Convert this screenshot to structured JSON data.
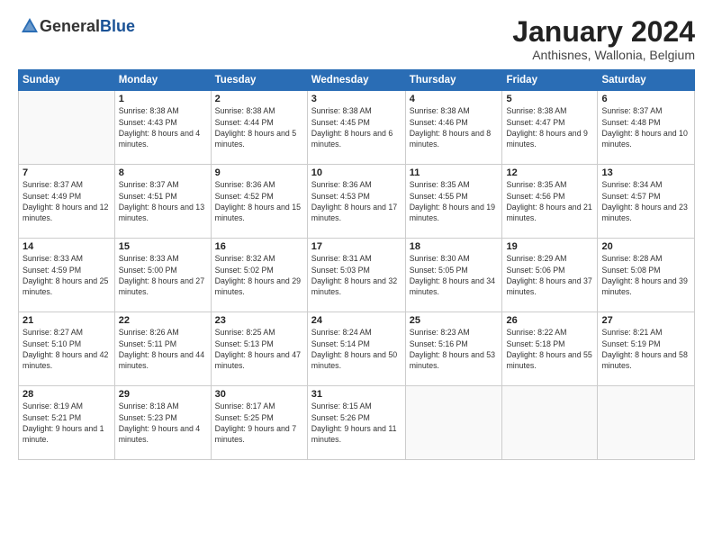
{
  "logo": {
    "general": "General",
    "blue": "Blue"
  },
  "title": "January 2024",
  "location": "Anthisnes, Wallonia, Belgium",
  "weekdays": [
    "Sunday",
    "Monday",
    "Tuesday",
    "Wednesday",
    "Thursday",
    "Friday",
    "Saturday"
  ],
  "weeks": [
    [
      {
        "day": "",
        "sunrise": "",
        "sunset": "",
        "daylight": ""
      },
      {
        "day": "1",
        "sunrise": "Sunrise: 8:38 AM",
        "sunset": "Sunset: 4:43 PM",
        "daylight": "Daylight: 8 hours and 4 minutes."
      },
      {
        "day": "2",
        "sunrise": "Sunrise: 8:38 AM",
        "sunset": "Sunset: 4:44 PM",
        "daylight": "Daylight: 8 hours and 5 minutes."
      },
      {
        "day": "3",
        "sunrise": "Sunrise: 8:38 AM",
        "sunset": "Sunset: 4:45 PM",
        "daylight": "Daylight: 8 hours and 6 minutes."
      },
      {
        "day": "4",
        "sunrise": "Sunrise: 8:38 AM",
        "sunset": "Sunset: 4:46 PM",
        "daylight": "Daylight: 8 hours and 8 minutes."
      },
      {
        "day": "5",
        "sunrise": "Sunrise: 8:38 AM",
        "sunset": "Sunset: 4:47 PM",
        "daylight": "Daylight: 8 hours and 9 minutes."
      },
      {
        "day": "6",
        "sunrise": "Sunrise: 8:37 AM",
        "sunset": "Sunset: 4:48 PM",
        "daylight": "Daylight: 8 hours and 10 minutes."
      }
    ],
    [
      {
        "day": "7",
        "sunrise": "Sunrise: 8:37 AM",
        "sunset": "Sunset: 4:49 PM",
        "daylight": "Daylight: 8 hours and 12 minutes."
      },
      {
        "day": "8",
        "sunrise": "Sunrise: 8:37 AM",
        "sunset": "Sunset: 4:51 PM",
        "daylight": "Daylight: 8 hours and 13 minutes."
      },
      {
        "day": "9",
        "sunrise": "Sunrise: 8:36 AM",
        "sunset": "Sunset: 4:52 PM",
        "daylight": "Daylight: 8 hours and 15 minutes."
      },
      {
        "day": "10",
        "sunrise": "Sunrise: 8:36 AM",
        "sunset": "Sunset: 4:53 PM",
        "daylight": "Daylight: 8 hours and 17 minutes."
      },
      {
        "day": "11",
        "sunrise": "Sunrise: 8:35 AM",
        "sunset": "Sunset: 4:55 PM",
        "daylight": "Daylight: 8 hours and 19 minutes."
      },
      {
        "day": "12",
        "sunrise": "Sunrise: 8:35 AM",
        "sunset": "Sunset: 4:56 PM",
        "daylight": "Daylight: 8 hours and 21 minutes."
      },
      {
        "day": "13",
        "sunrise": "Sunrise: 8:34 AM",
        "sunset": "Sunset: 4:57 PM",
        "daylight": "Daylight: 8 hours and 23 minutes."
      }
    ],
    [
      {
        "day": "14",
        "sunrise": "Sunrise: 8:33 AM",
        "sunset": "Sunset: 4:59 PM",
        "daylight": "Daylight: 8 hours and 25 minutes."
      },
      {
        "day": "15",
        "sunrise": "Sunrise: 8:33 AM",
        "sunset": "Sunset: 5:00 PM",
        "daylight": "Daylight: 8 hours and 27 minutes."
      },
      {
        "day": "16",
        "sunrise": "Sunrise: 8:32 AM",
        "sunset": "Sunset: 5:02 PM",
        "daylight": "Daylight: 8 hours and 29 minutes."
      },
      {
        "day": "17",
        "sunrise": "Sunrise: 8:31 AM",
        "sunset": "Sunset: 5:03 PM",
        "daylight": "Daylight: 8 hours and 32 minutes."
      },
      {
        "day": "18",
        "sunrise": "Sunrise: 8:30 AM",
        "sunset": "Sunset: 5:05 PM",
        "daylight": "Daylight: 8 hours and 34 minutes."
      },
      {
        "day": "19",
        "sunrise": "Sunrise: 8:29 AM",
        "sunset": "Sunset: 5:06 PM",
        "daylight": "Daylight: 8 hours and 37 minutes."
      },
      {
        "day": "20",
        "sunrise": "Sunrise: 8:28 AM",
        "sunset": "Sunset: 5:08 PM",
        "daylight": "Daylight: 8 hours and 39 minutes."
      }
    ],
    [
      {
        "day": "21",
        "sunrise": "Sunrise: 8:27 AM",
        "sunset": "Sunset: 5:10 PM",
        "daylight": "Daylight: 8 hours and 42 minutes."
      },
      {
        "day": "22",
        "sunrise": "Sunrise: 8:26 AM",
        "sunset": "Sunset: 5:11 PM",
        "daylight": "Daylight: 8 hours and 44 minutes."
      },
      {
        "day": "23",
        "sunrise": "Sunrise: 8:25 AM",
        "sunset": "Sunset: 5:13 PM",
        "daylight": "Daylight: 8 hours and 47 minutes."
      },
      {
        "day": "24",
        "sunrise": "Sunrise: 8:24 AM",
        "sunset": "Sunset: 5:14 PM",
        "daylight": "Daylight: 8 hours and 50 minutes."
      },
      {
        "day": "25",
        "sunrise": "Sunrise: 8:23 AM",
        "sunset": "Sunset: 5:16 PM",
        "daylight": "Daylight: 8 hours and 53 minutes."
      },
      {
        "day": "26",
        "sunrise": "Sunrise: 8:22 AM",
        "sunset": "Sunset: 5:18 PM",
        "daylight": "Daylight: 8 hours and 55 minutes."
      },
      {
        "day": "27",
        "sunrise": "Sunrise: 8:21 AM",
        "sunset": "Sunset: 5:19 PM",
        "daylight": "Daylight: 8 hours and 58 minutes."
      }
    ],
    [
      {
        "day": "28",
        "sunrise": "Sunrise: 8:19 AM",
        "sunset": "Sunset: 5:21 PM",
        "daylight": "Daylight: 9 hours and 1 minute."
      },
      {
        "day": "29",
        "sunrise": "Sunrise: 8:18 AM",
        "sunset": "Sunset: 5:23 PM",
        "daylight": "Daylight: 9 hours and 4 minutes."
      },
      {
        "day": "30",
        "sunrise": "Sunrise: 8:17 AM",
        "sunset": "Sunset: 5:25 PM",
        "daylight": "Daylight: 9 hours and 7 minutes."
      },
      {
        "day": "31",
        "sunrise": "Sunrise: 8:15 AM",
        "sunset": "Sunset: 5:26 PM",
        "daylight": "Daylight: 9 hours and 11 minutes."
      },
      {
        "day": "",
        "sunrise": "",
        "sunset": "",
        "daylight": ""
      },
      {
        "day": "",
        "sunrise": "",
        "sunset": "",
        "daylight": ""
      },
      {
        "day": "",
        "sunrise": "",
        "sunset": "",
        "daylight": ""
      }
    ]
  ]
}
